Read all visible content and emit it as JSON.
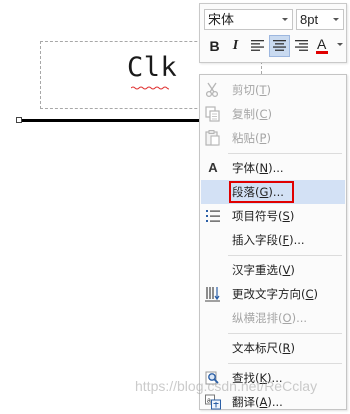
{
  "document": {
    "text": "Clk"
  },
  "mini_toolbar": {
    "font_name": "宋体",
    "font_size": "8pt",
    "bold": "B",
    "italic": "I",
    "font_color_letter": "A",
    "font_color": "#e00000",
    "active_button": "align-center"
  },
  "menu": {
    "items": [
      {
        "label": "剪切",
        "key": "T",
        "icon": "scissors-icon",
        "disabled": true
      },
      {
        "label": "复制",
        "key": "C",
        "icon": "copy-icon",
        "disabled": true
      },
      {
        "label": "粘贴",
        "key": "P",
        "icon": "paste-icon",
        "disabled": true
      },
      {
        "label": "字体",
        "key": "N",
        "suffix": "...",
        "icon": "font-icon",
        "disabled": false
      },
      {
        "label": "段落",
        "key": "G",
        "suffix": "...",
        "icon": "",
        "disabled": false,
        "highlighted": true
      },
      {
        "label": "项目符号",
        "key": "S",
        "icon": "bullets-icon",
        "disabled": false
      },
      {
        "label": "插入字段",
        "key": "F",
        "suffix": "...",
        "icon": "",
        "disabled": false
      },
      {
        "label": "汉字重选",
        "key": "V",
        "icon": "",
        "disabled": false
      },
      {
        "label": "更改文字方向",
        "key": "C",
        "icon": "text-direction-icon",
        "disabled": false
      },
      {
        "label": "纵横混排",
        "key": "O",
        "suffix": "...",
        "icon": "",
        "disabled": true
      },
      {
        "label": "文本标尺",
        "key": "R",
        "icon": "",
        "disabled": false
      },
      {
        "label": "查找",
        "key": "K",
        "suffix": "...",
        "icon": "find-icon",
        "disabled": false
      },
      {
        "label": "翻译",
        "key": "A",
        "suffix": "...",
        "icon": "translate-icon",
        "disabled": false
      }
    ]
  },
  "watermark": "https://blog.csdn.net/ReCclay"
}
